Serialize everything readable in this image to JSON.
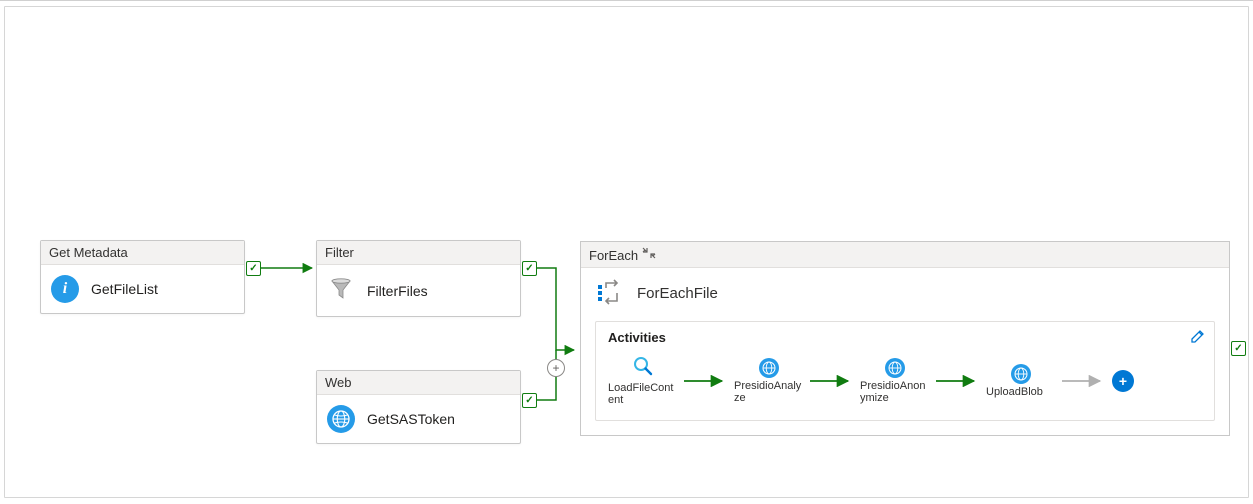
{
  "nodes": {
    "getMetadata": {
      "type": "Get Metadata",
      "name": "GetFileList"
    },
    "filter": {
      "type": "Filter",
      "name": "FilterFiles"
    },
    "web": {
      "type": "Web",
      "name": "GetSASToken"
    },
    "foreach": {
      "type": "ForEach",
      "name": "ForEachFile"
    }
  },
  "activities": {
    "section_title": "Activities",
    "items": [
      {
        "label": "LoadFileContent"
      },
      {
        "label": "PresidioAnalyze"
      },
      {
        "label": "PresidioAnonymize"
      },
      {
        "label": "UploadBlob"
      }
    ]
  },
  "status": {
    "success": "✓"
  }
}
